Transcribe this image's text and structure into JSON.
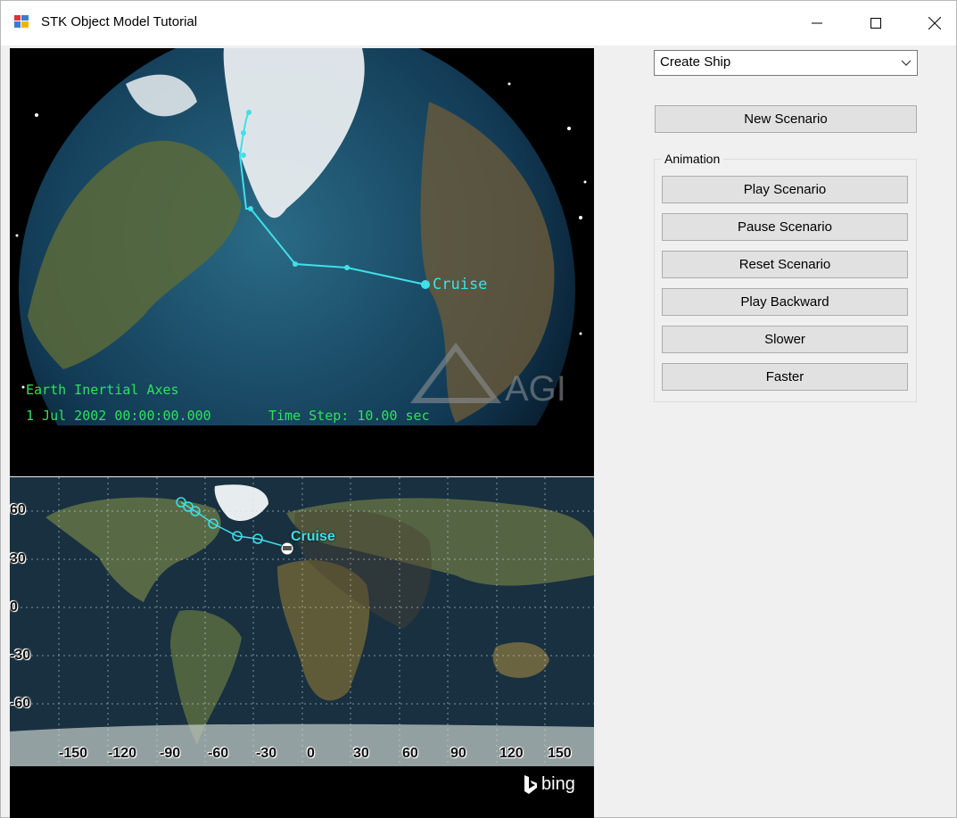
{
  "window": {
    "title": "STK Object Model Tutorial"
  },
  "globe": {
    "overlay_axes": "Earth Inertial Axes",
    "overlay_time": "1 Jul 2002 00:00:00.000",
    "overlay_step": "Time Step: 10.00 sec",
    "ship_label": "Cruise",
    "watermark": "AGI"
  },
  "map": {
    "ship_label": "Cruise",
    "lat_labels": [
      "60",
      "30",
      "0",
      "-30",
      "-60"
    ],
    "lon_labels": [
      "-150",
      "-120",
      "-90",
      "-60",
      "-30",
      "0",
      "30",
      "60",
      "90",
      "120",
      "150"
    ],
    "attribution": "bing"
  },
  "controls": {
    "object_select": "Create Ship",
    "new_scenario": "New Scenario",
    "animation_group": "Animation",
    "play": "Play Scenario",
    "pause": "Pause Scenario",
    "reset": "Reset Scenario",
    "play_backward": "Play Backward",
    "slower": "Slower",
    "faster": "Faster"
  },
  "colors": {
    "overlay_text": "#2fe25a",
    "track": "#3fe0e8",
    "button_face": "#e1e1e1"
  }
}
